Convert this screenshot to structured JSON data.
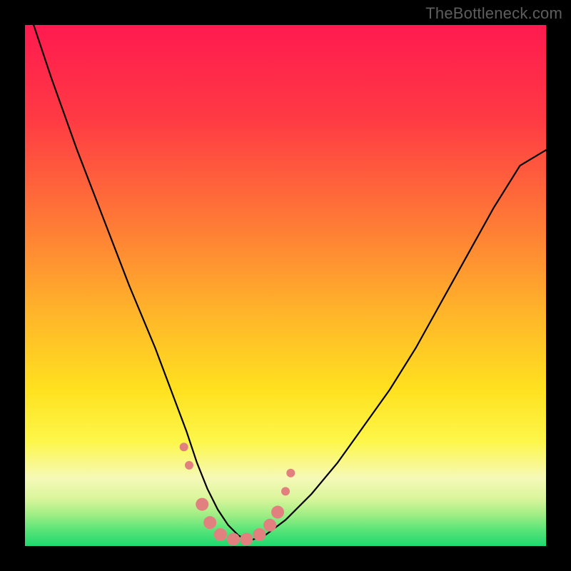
{
  "watermark": "TheBottleneck.com",
  "chart_data": {
    "type": "line",
    "title": "",
    "xlabel": "",
    "ylabel": "",
    "xlim": [
      0,
      100
    ],
    "ylim": [
      0,
      100
    ],
    "grid": false,
    "legend": false,
    "gradient_stops": [
      {
        "pct": 0,
        "color": "#ff1a4f"
      },
      {
        "pct": 18,
        "color": "#ff3a44"
      },
      {
        "pct": 38,
        "color": "#ff7a36"
      },
      {
        "pct": 55,
        "color": "#ffb42a"
      },
      {
        "pct": 70,
        "color": "#ffe11f"
      },
      {
        "pct": 80,
        "color": "#fdf74a"
      },
      {
        "pct": 87,
        "color": "#f6f9b8"
      },
      {
        "pct": 91,
        "color": "#d8f59a"
      },
      {
        "pct": 94,
        "color": "#9fee85"
      },
      {
        "pct": 97,
        "color": "#57e478"
      },
      {
        "pct": 100,
        "color": "#1fd86f"
      }
    ],
    "series": [
      {
        "name": "bottleneck-curve",
        "color": "#000000",
        "width": 2.2,
        "x": [
          0,
          5,
          10,
          15,
          20,
          25,
          28,
          31,
          33,
          35,
          37,
          39,
          41,
          43,
          46,
          50,
          55,
          60,
          65,
          70,
          75,
          80,
          85,
          90,
          95,
          100
        ],
        "values": [
          105,
          90,
          76,
          63,
          50,
          38,
          30,
          22,
          16,
          11,
          7,
          4,
          2,
          1,
          2,
          5,
          10,
          16,
          23,
          30,
          38,
          47,
          56,
          65,
          73,
          76
        ]
      }
    ],
    "markers": {
      "name": "highlight-dots",
      "color": "#e28080",
      "radius_large": 9,
      "radius_small": 6,
      "points": [
        {
          "x": 30.5,
          "y": 19
        },
        {
          "x": 31.5,
          "y": 15.5
        },
        {
          "x": 34.0,
          "y": 8
        },
        {
          "x": 35.5,
          "y": 4.5
        },
        {
          "x": 37.5,
          "y": 2.2
        },
        {
          "x": 40.0,
          "y": 1.3
        },
        {
          "x": 42.5,
          "y": 1.3
        },
        {
          "x": 45.0,
          "y": 2.2
        },
        {
          "x": 47.0,
          "y": 4.0
        },
        {
          "x": 48.5,
          "y": 6.5
        },
        {
          "x": 50.0,
          "y": 10.5
        },
        {
          "x": 51.0,
          "y": 14.0
        }
      ]
    }
  }
}
